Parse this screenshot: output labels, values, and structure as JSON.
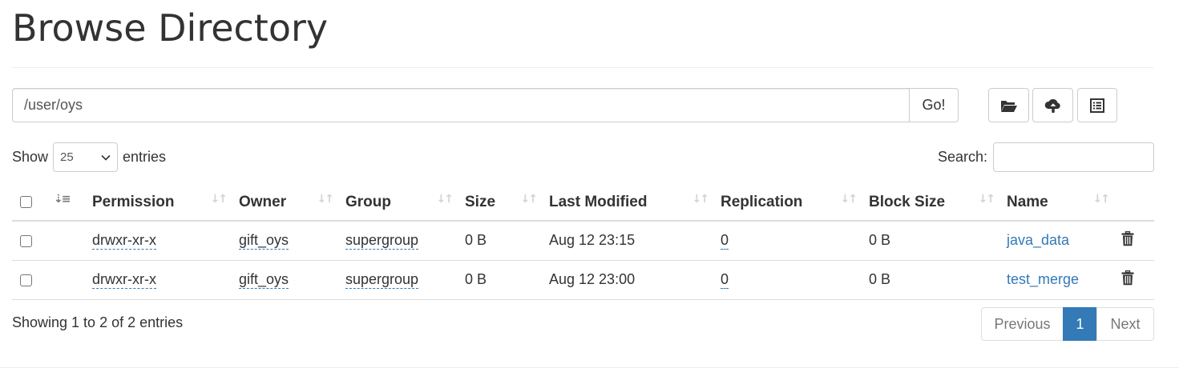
{
  "page": {
    "title": "Browse Directory"
  },
  "path_bar": {
    "value": "/user/oys",
    "go_label": "Go!"
  },
  "toolbar": {
    "icons": [
      "folder-open-icon",
      "cloud-upload-icon",
      "list-alt-icon"
    ]
  },
  "controls": {
    "show_label": "Show",
    "entries_value": "25",
    "entries_label": "entries",
    "search_label": "Search:",
    "search_value": ""
  },
  "table": {
    "columns": [
      "Permission",
      "Owner",
      "Group",
      "Size",
      "Last Modified",
      "Replication",
      "Block Size",
      "Name"
    ],
    "rows": [
      {
        "permission": "drwxr-xr-x",
        "owner": "gift_oys",
        "group": "supergroup",
        "size": "0 B",
        "modified": "Aug 12 23:15",
        "replication": "0",
        "block_size": "0 B",
        "name": "java_data"
      },
      {
        "permission": "drwxr-xr-x",
        "owner": "gift_oys",
        "group": "supergroup",
        "size": "0 B",
        "modified": "Aug 12 23:00",
        "replication": "0",
        "block_size": "0 B",
        "name": "test_merge"
      }
    ]
  },
  "footer": {
    "info": "Showing 1 to 2 of 2 entries",
    "previous": "Previous",
    "current_page": "1",
    "next": "Next"
  },
  "colors": {
    "link": "#337ab7",
    "active_page": "#337ab7"
  }
}
